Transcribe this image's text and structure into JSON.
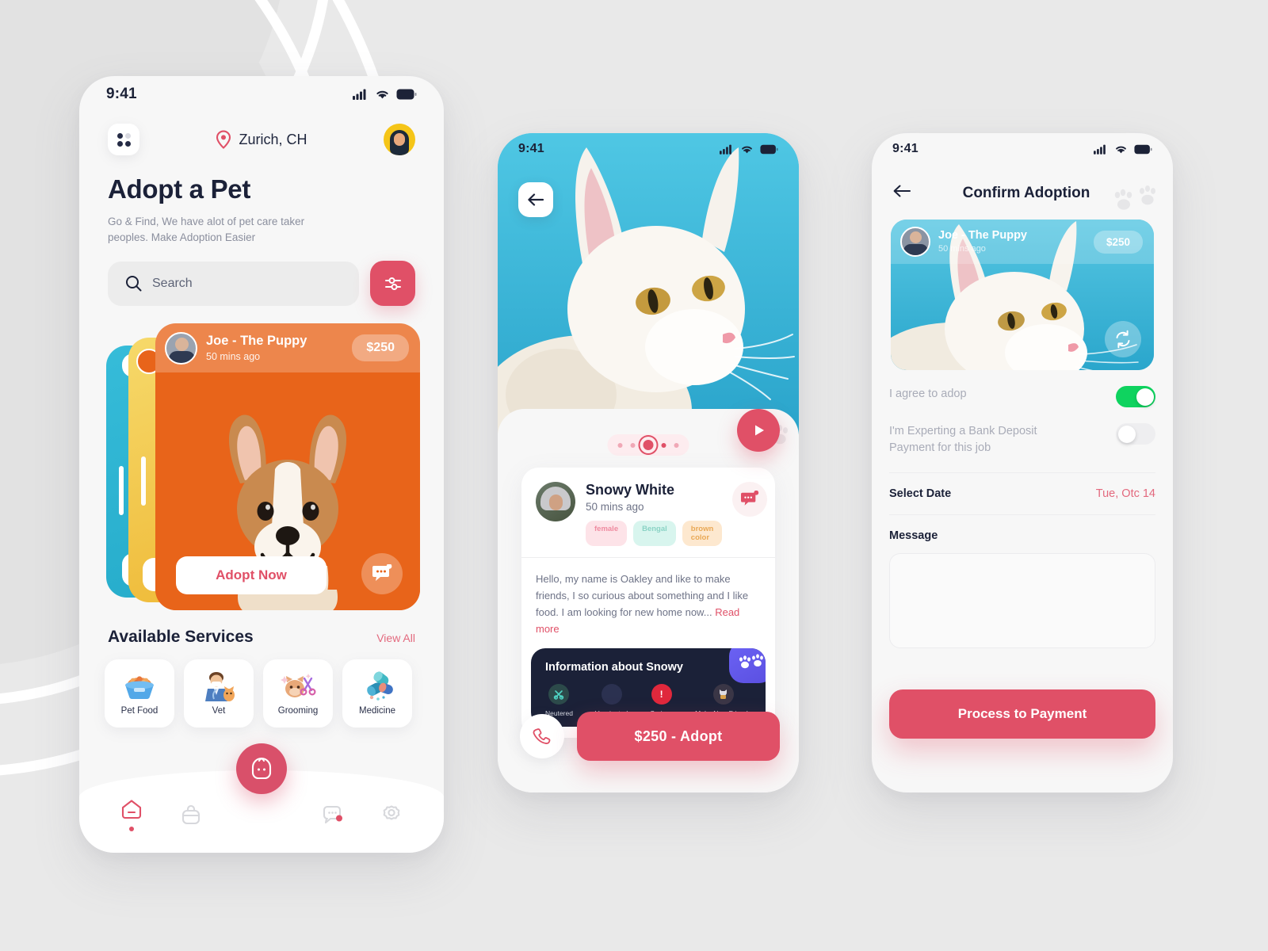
{
  "background": {
    "color": "#e9e9e9",
    "arc_color": "#e2e2e2",
    "arc_stroke": "#ffffff"
  },
  "theme": {
    "accent_pink": "#e05067",
    "accent_pink_soft": "#e3697e",
    "dark_navy": "#1b2138",
    "card_orange": "#e8641a",
    "card_yellow": "#f0c040",
    "card_blue": "#30b8d8",
    "toggle_green": "#0fd35f",
    "paw_badge_purple": "#6c63f5"
  },
  "screen_home": {
    "status_bar": {
      "time": "9:41",
      "signal_icon": "cellular-signal-icon",
      "wifi_icon": "wifi-icon",
      "battery_icon": "battery-icon"
    },
    "grid_button_icon": "grid-menu-icon",
    "location": {
      "icon": "location-pin-icon",
      "text": "Zurich, CH"
    },
    "avatar_icon": "user-avatar",
    "title": "Adopt a Pet",
    "subtitle": "Go & Find, We have alot of pet care taker peoples. Make Adoption Easier",
    "search": {
      "placeholder": "Search",
      "icon": "search-icon"
    },
    "filter_button_icon": "filter-sliders-icon",
    "card": {
      "owner_name": "Joe - The Puppy",
      "timestamp": "50 mins ago",
      "price": "$250",
      "adopt_label": "Adopt Now",
      "chat_icon": "chat-bubble-icon",
      "avatar_icon": "owner-avatar",
      "pet_image": "corgi-puppy-photo"
    },
    "services": {
      "title": "Available Services",
      "view_all": "View All",
      "items": [
        {
          "label": "Pet Food",
          "icon": "pet-food-bowl-icon"
        },
        {
          "label": "Vet",
          "icon": "veterinarian-icon"
        },
        {
          "label": "Grooming",
          "icon": "grooming-scissors-icon"
        },
        {
          "label": "Medicine",
          "icon": "medicine-pills-icon"
        }
      ]
    },
    "nav": {
      "fab_icon": "pet-bag-icon",
      "items": [
        {
          "icon": "home-icon",
          "active": true
        },
        {
          "icon": "briefcase-icon",
          "active": false
        },
        {
          "icon": "chat-icon",
          "active": false,
          "badge": true
        },
        {
          "icon": "settings-gear-icon",
          "active": false
        }
      ]
    }
  },
  "screen_detail": {
    "status_bar": {
      "time": "9:41"
    },
    "back_icon": "arrow-left-icon",
    "hero_image": "white-cat-photo",
    "carousel": {
      "total": 5,
      "active_index": 2
    },
    "play_icon": "play-icon",
    "pet": {
      "name": "Snowy White",
      "timestamp": "50 mins ago",
      "avatar_icon": "owner-avatar",
      "message_icon": "chat-bubble-icon",
      "tags": [
        {
          "label": "female",
          "style": "female"
        },
        {
          "label": "Bengal",
          "style": "bengal"
        },
        {
          "label": "brown color",
          "style": "brown"
        }
      ],
      "description": "Hello, my name is Oakley and like to make friends, I so curious about something and I like food. I am looking for new home now...",
      "read_more": "Read more"
    },
    "info_panel": {
      "title": "Information about Snowy",
      "badge_icon": "paw-prints-icon",
      "items": [
        {
          "label": "Neutered",
          "icon": "neutered-icon"
        },
        {
          "label": "Vaccinated",
          "icon": "vaccinated-icon"
        },
        {
          "label": "Curious",
          "icon": "curious-alert-icon"
        },
        {
          "label": "Make New Friends",
          "icon": "friends-cat-icon"
        }
      ]
    },
    "actions": {
      "call_icon": "phone-icon",
      "adopt_label": "$250  -  Adopt"
    }
  },
  "screen_confirm": {
    "status_bar": {
      "time": "9:41"
    },
    "back_icon": "arrow-left-icon",
    "title": "Confirm Adoption",
    "paw_decor_icon": "paw-prints-icon",
    "card": {
      "owner_name": "Joe - The Puppy",
      "timestamp": "50 mins ago",
      "price": "$250",
      "refresh_icon": "refresh-swap-icon",
      "pet_image": "white-cat-photo"
    },
    "toggles": [
      {
        "label": "I agree to adop",
        "on": true
      },
      {
        "label": "I'm Experting a Bank Deposit Payment for this job",
        "on": false
      }
    ],
    "date_row": {
      "label": "Select Date",
      "value": "Tue, Otc 14"
    },
    "message": {
      "label": "Message",
      "value": "",
      "placeholder": ""
    },
    "submit_label": "Process to Payment"
  }
}
